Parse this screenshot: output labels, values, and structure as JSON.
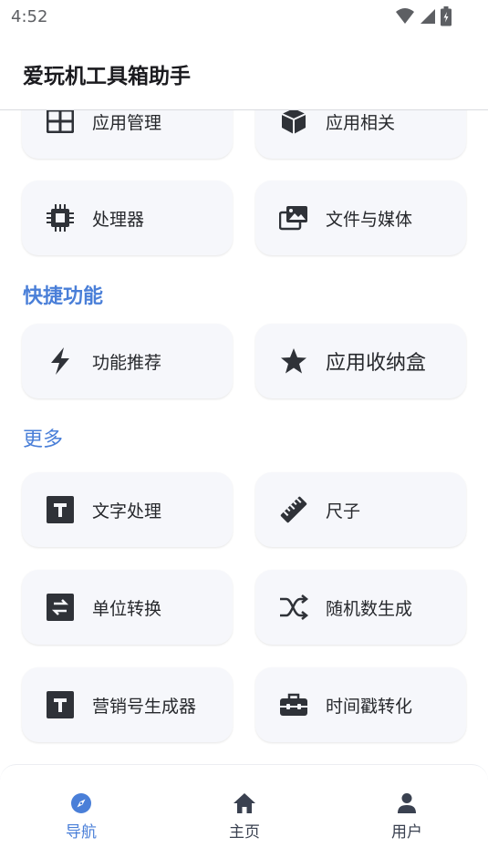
{
  "status_bar": {
    "time": "4:52"
  },
  "app_bar": {
    "title": "爱玩机工具箱助手"
  },
  "sections": {
    "quick": "快捷功能",
    "more": "更多"
  },
  "cards": {
    "app_manage": "应用管理",
    "app_related": "应用相关",
    "processor": "处理器",
    "files_media": "文件与媒体",
    "feature_recommend": "功能推荐",
    "app_box": "应用收纳盒",
    "text_process": "文字处理",
    "ruler": "尺子",
    "unit_convert": "单位转换",
    "random_number": "随机数生成",
    "marketing_generator": "营销号生成器",
    "timestamp_convert": "时间戳转化"
  },
  "nav": {
    "items": [
      {
        "label": "导航",
        "icon": "compass-icon",
        "active": true
      },
      {
        "label": "主页",
        "icon": "home-icon",
        "active": false
      },
      {
        "label": "用户",
        "icon": "person-icon",
        "active": false
      }
    ]
  },
  "colors": {
    "accent": "#4a7fd8",
    "card_bg": "#f6f7fb",
    "icon_dark": "#2f3238",
    "nav_inactive": "#3a4150"
  }
}
